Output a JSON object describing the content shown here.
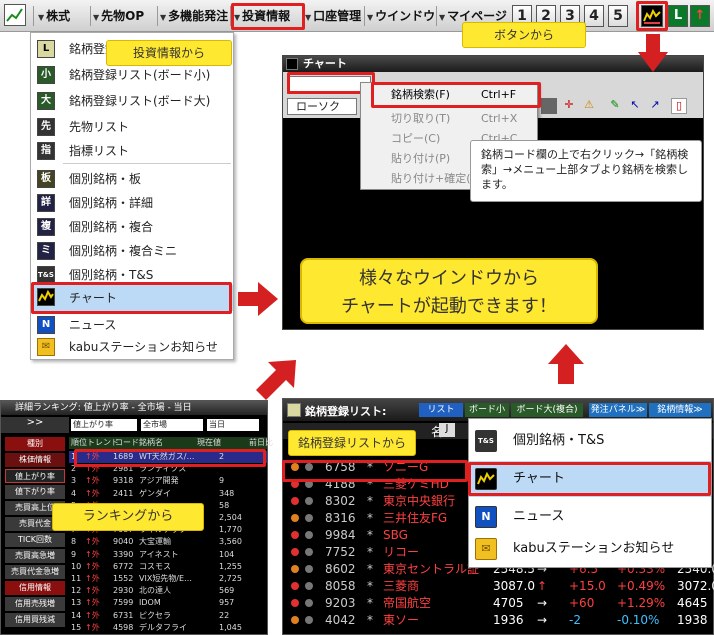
{
  "topbar": {
    "logo_icon": "chart-line-icon",
    "items": [
      "株式",
      "先物OP",
      "多機能発注",
      "投資情報",
      "口座管理",
      "ウインドウ",
      "マイページ"
    ],
    "num_buttons": [
      "1",
      "2",
      "3",
      "4",
      "5"
    ]
  },
  "dropdown": {
    "items": [
      {
        "label": "銘柄登録リスト(一覧)",
        "icon": "L"
      },
      {
        "label": "銘柄登録リスト(ボード小)",
        "icon": "小"
      },
      {
        "label": "銘柄登録リスト(ボード大)",
        "icon": "大"
      },
      {
        "label": "先物リスト",
        "icon": "先"
      },
      {
        "label": "指標リスト",
        "icon": "指"
      },
      {
        "label": "個別銘柄・板",
        "icon": "板"
      },
      {
        "label": "個別銘柄・詳細",
        "icon": "詳"
      },
      {
        "label": "個別銘柄・複合",
        "icon": "複"
      },
      {
        "label": "個別銘柄・複合ミニ",
        "icon": "ミ"
      },
      {
        "label": "個別銘柄・T&S",
        "icon": "T&S"
      },
      {
        "label": "チャート",
        "icon": "chart"
      },
      {
        "label": "ニュース",
        "icon": "N"
      },
      {
        "label": "kabuステーションお知らせ",
        "icon": "mail"
      }
    ],
    "selected": "チャート"
  },
  "callouts": {
    "from_info": "投資情報から",
    "from_button": "ボタンから",
    "from_ranking": "ランキングから",
    "from_watchlist": "銘柄登録リストから",
    "main_line1": "様々なウインドウから",
    "main_line2": "チャートが起動できます！"
  },
  "chart_window": {
    "title": "チャート",
    "chart_type": "ローソク"
  },
  "context_menu": [
    {
      "label": "銘柄検索(F)",
      "key": "Ctrl+F",
      "enabled": true
    },
    {
      "label": "切り取り(T)",
      "key": "Ctrl+X",
      "enabled": false
    },
    {
      "label": "コピー(C)",
      "key": "Ctrl+C",
      "enabled": false
    },
    {
      "label": "貼り付け(P)",
      "key": "",
      "enabled": false
    },
    {
      "label": "貼り付け+確定(E)",
      "key": "",
      "enabled": false
    }
  ],
  "note": "銘柄コード欄の上で右クリック→「銘柄検索」→メニュー上部タブより銘柄を検索します。",
  "ranking": {
    "title": "詳細ランキング: 値上がり率 - 全市場 - 当日",
    "filters": [
      "値上がり率",
      "全市場",
      "当日"
    ],
    "side_items": [
      "種別",
      "株価情報",
      "値上がり率",
      "値下がり率",
      "売買高上位",
      "売買代金",
      "TICK回数",
      "売買高急増",
      "売買代金急増",
      "信用情報",
      "信用売残増",
      "信用買残減"
    ],
    "headers": [
      "順位",
      "トレンド",
      "コード",
      "銘柄名",
      "現在値",
      "前日比"
    ],
    "rows": [
      [
        "1",
        "↑外",
        "1689",
        "WT天然ガス/…",
        "2"
      ],
      [
        "2",
        "↑外",
        "2981",
        "ランディクス",
        ""
      ],
      [
        "3",
        "↑外",
        "9318",
        "アジア開発",
        "9"
      ],
      [
        "4",
        "↑外",
        "2411",
        "ゲンダイ",
        "348"
      ],
      [
        "5",
        "↑外",
        "",
        "",
        "58"
      ],
      [
        "6",
        "↑外",
        "",
        "",
        "2,504"
      ],
      [
        "7",
        "↑外",
        "7087",
        "ウイルテック",
        "1,770"
      ],
      [
        "8",
        "↑外",
        "9040",
        "大宝運輸",
        "3,560"
      ],
      [
        "9",
        "↑外",
        "3390",
        "アイネスト",
        "104"
      ],
      [
        "10",
        "↑外",
        "6772",
        "コスモス",
        "1,255"
      ],
      [
        "11",
        "↑外",
        "1552",
        "VIX短先物/E…",
        "2,725"
      ],
      [
        "12",
        "↑外",
        "2930",
        "北の達人",
        "569"
      ],
      [
        "13",
        "↑外",
        "7599",
        "IDOM",
        "957"
      ],
      [
        "14",
        "↑外",
        "6731",
        "ピクセラ",
        "22"
      ],
      [
        "15",
        "↑外",
        "4598",
        "デルタフライ",
        "1,045"
      ]
    ]
  },
  "watchlist": {
    "title": "銘柄登録リスト:",
    "tabs": [
      "リスト",
      "ボード小",
      "ボード大(複合)"
    ],
    "order_btn": "発注パネル≫",
    "info_btn": "銘柄情報≫",
    "col_name": "名",
    "rows": [
      {
        "code": "6758",
        "name": "ソニーG",
        "price": "",
        "arrow": "",
        "chg": "",
        "pct": "",
        "last": ""
      },
      {
        "code": "4188",
        "name": "三菱ケミHD",
        "price": "",
        "arrow": "",
        "chg": "",
        "pct": "",
        "last": ""
      },
      {
        "code": "8302",
        "name": "東京中央銀行",
        "price": "",
        "arrow": "",
        "chg": "",
        "pct": "",
        "last": ""
      },
      {
        "code": "8316",
        "name": "三井住友FG",
        "price": "",
        "arrow": "",
        "chg": "",
        "pct": "",
        "last": ""
      },
      {
        "code": "9984",
        "name": "SBG",
        "price": "",
        "arrow": "",
        "chg": "",
        "pct": "",
        "last": ""
      },
      {
        "code": "7752",
        "name": "リコー",
        "price": "",
        "arrow": "",
        "chg": "",
        "pct": "",
        "last": ""
      },
      {
        "code": "8602",
        "name": "東京セントラル証",
        "price": "2548.5",
        "arrow": "→",
        "chg": "+6.5",
        "pct": "+0.33%",
        "last": "2540.0"
      },
      {
        "code": "8058",
        "name": "三菱商",
        "price": "3087.0",
        "arrow": "↑",
        "chg": "+15.0",
        "pct": "+0.49%",
        "last": "3072.0"
      },
      {
        "code": "9203",
        "name": "帝国航空",
        "price": "4705",
        "arrow": "→",
        "chg": "+60",
        "pct": "+1.29%",
        "last": "4645"
      },
      {
        "code": "4042",
        "name": "東ソー",
        "price": "1936",
        "arrow": "→",
        "chg": "-2",
        "pct": "-0.10%",
        "last": "1938"
      }
    ],
    "menu": [
      {
        "label": "個別銘柄・T&S",
        "icon": "T&S"
      },
      {
        "label": "チャート",
        "icon": "chart"
      },
      {
        "label": "ニュース",
        "icon": "N"
      },
      {
        "label": "kabuステーションお知らせ",
        "icon": "mail"
      }
    ]
  },
  "colors": {
    "red": "#e02020",
    "yellow": "#ffe830",
    "highlight": "#bcd9f5"
  }
}
